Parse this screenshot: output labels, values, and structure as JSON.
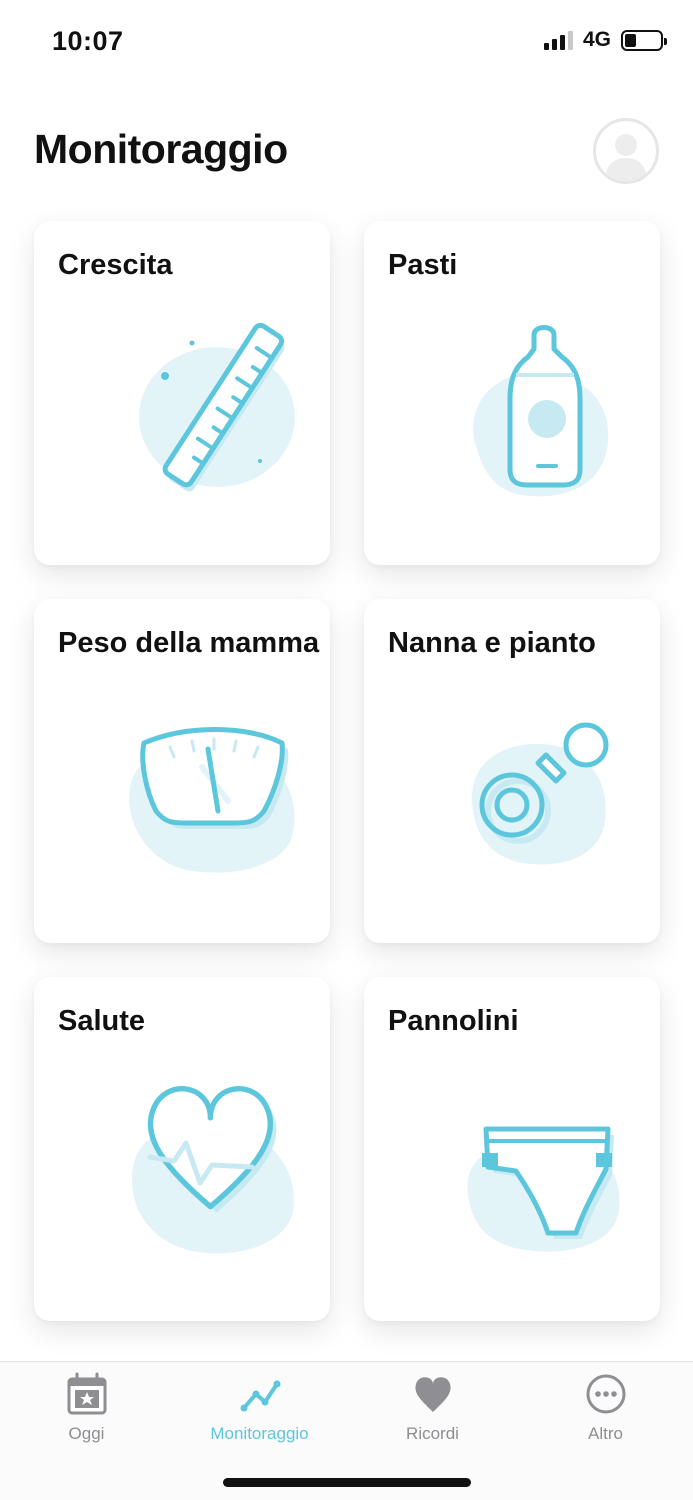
{
  "status_bar": {
    "time": "10:07",
    "network": "4G"
  },
  "header": {
    "title": "Monitoraggio"
  },
  "cards": [
    {
      "title": "Crescita",
      "icon": "ruler-icon"
    },
    {
      "title": "Pasti",
      "icon": "baby-bottle-icon"
    },
    {
      "title": "Peso della mamma",
      "icon": "scale-icon"
    },
    {
      "title": "Nanna e pianto",
      "icon": "pacifier-icon"
    },
    {
      "title": "Salute",
      "icon": "heart-icon"
    },
    {
      "title": "Pannolini",
      "icon": "diaper-icon"
    }
  ],
  "tab_bar": {
    "tabs": [
      {
        "label": "Oggi",
        "icon": "calendar-star-icon",
        "active": false
      },
      {
        "label": "Monitoraggio",
        "icon": "trend-line-icon",
        "active": true
      },
      {
        "label": "Ricordi",
        "icon": "heart-icon",
        "active": false
      },
      {
        "label": "Altro",
        "icon": "more-dots-icon",
        "active": false
      }
    ]
  },
  "colors": {
    "accent": "#5bc6dc",
    "illustration_stroke": "#5bc6dc",
    "illustration_blob": "#e3f4f9",
    "inactive_tab": "#8e8e93"
  }
}
